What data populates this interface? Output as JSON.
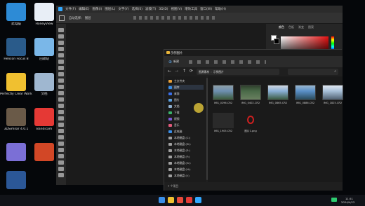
{
  "desktop": {
    "icons": [
      {
        "label": "此电脑",
        "icon": "computer-icon",
        "color": "#2d8bd6"
      },
      {
        "label": "HoneyView",
        "icon": "honeyview-icon",
        "color": "#e8eef6"
      },
      {
        "label": "Helicon Focus 8",
        "icon": "helicon-focus-icon",
        "color": "#2a5b8a"
      },
      {
        "label": "回收站",
        "icon": "recycle-bin-icon",
        "color": "#7ab7e8"
      },
      {
        "label": "Perfectly Clear WorkBench",
        "icon": "perfectly-clear-icon",
        "color": "#f0c030"
      },
      {
        "label": "文档",
        "icon": "documents-icon",
        "color": "#9fb7d0"
      },
      {
        "label": "3DSimilar 4.0.1",
        "icon": "3d-app-icon",
        "color": "#6a5a48"
      },
      {
        "label": "Bandicam",
        "icon": "bandicam-icon",
        "color": "#e53935"
      },
      {
        "label": "",
        "icon": "one-app-icon",
        "color": "#7b6fd6"
      },
      {
        "label": "",
        "icon": "powerpoint-icon",
        "color": "#d24726"
      },
      {
        "label": "",
        "icon": "word-icon",
        "color": "#2b5797"
      }
    ]
  },
  "photoshop": {
    "menu": [
      "文件(F)",
      "编辑(E)",
      "图像(I)",
      "图层(L)",
      "文字(Y)",
      "选择(S)",
      "滤镜(T)",
      "3D(D)",
      "视图(V)",
      "增效工具",
      "窗口(W)",
      "帮助(H)"
    ],
    "options_text": "自动选择：  图层",
    "panel_tabs": [
      "颜色",
      "色板",
      "渐变",
      "图案"
    ],
    "accent": "#e81010"
  },
  "explorer": {
    "title": "示例图片",
    "new_button": "新建",
    "breadcrumb": [
      "图源素材",
      "示例图片"
    ],
    "nav_items": [
      {
        "label": "主文件夹",
        "icon": "home-icon",
        "color": "#e8a13a"
      },
      {
        "label": "图库",
        "icon": "gallery-icon",
        "color": "#3a8ee8"
      },
      {
        "label": "桌面",
        "icon": "desktop-icon",
        "color": "#3a6fe8"
      },
      {
        "label": "图片",
        "icon": "pictures-icon",
        "color": "#5aa0e0"
      },
      {
        "label": "文档",
        "icon": "documents-icon",
        "color": "#8fb0d0"
      },
      {
        "label": "下载",
        "icon": "download-icon",
        "color": "#3ab36b"
      },
      {
        "label": "视频",
        "icon": "video-icon",
        "color": "#7b5ad6"
      },
      {
        "label": "音乐",
        "icon": "music-icon",
        "color": "#e05a7a"
      },
      {
        "label": "此电脑",
        "icon": "computer-icon",
        "color": "#3a8ee8"
      },
      {
        "label": "本地磁盘 (C:)",
        "icon": "drive-icon",
        "color": "#a0a0a0"
      },
      {
        "label": "本地磁盘 (D:)",
        "icon": "drive-icon",
        "color": "#a0a0a0"
      },
      {
        "label": "本地磁盘 (E:)",
        "icon": "drive-icon",
        "color": "#a0a0a0"
      },
      {
        "label": "本地磁盘 (F:)",
        "icon": "drive-icon",
        "color": "#a0a0a0"
      },
      {
        "label": "本地磁盘 (G:)",
        "icon": "drive-icon",
        "color": "#a0a0a0"
      },
      {
        "label": "本地磁盘 (H:)",
        "icon": "drive-icon",
        "color": "#a0a0a0"
      },
      {
        "label": "本地磁盘 (I:)",
        "icon": "drive-icon",
        "color": "#a0a0a0"
      }
    ],
    "files": [
      {
        "name": "IMG_0296.CR2",
        "palette": [
          "#6d8fb0",
          "#3c5a3a",
          "#8fa0a8"
        ]
      },
      {
        "name": "IMG_0402.CR2",
        "palette": [
          "#4a6a48",
          "#6a8060",
          "#2e3e2c"
        ]
      },
      {
        "name": "IMG_0865.CR2",
        "palette": [
          "#8ab0d6",
          "#3a5a40",
          "#d0d8e0"
        ]
      },
      {
        "name": "IMG_0886.CR2",
        "palette": [
          "#5a90c8",
          "#2a4a5a",
          "#9ab8d0"
        ]
      },
      {
        "name": "IMG_1825.CR2",
        "palette": [
          "#a8c0d8",
          "#506070",
          "#e0e8f0"
        ]
      },
      {
        "name": "IMG_1905.CR2",
        "palette": [
          "#1a1a1a",
          "#2a2a2a",
          "#3a3a3a"
        ]
      },
      {
        "name": "图片1.png",
        "palette": [
          "#1a1a1a",
          "#d02020",
          "#1a1a1a"
        ]
      }
    ],
    "status": "7 个项目"
  },
  "taskbar": {
    "apps": [
      {
        "icon": "windows-start-icon",
        "color": "#3a8ee8"
      },
      {
        "icon": "file-explorer-icon",
        "color": "#f0c030"
      },
      {
        "icon": "chrome-icon",
        "color": "#e84a3a"
      },
      {
        "icon": "bandicam-icon",
        "color": "#e53935"
      },
      {
        "icon": "photoshop-icon",
        "color": "#31a8ff"
      }
    ],
    "time": "11:51",
    "date": "2024/4/12"
  }
}
